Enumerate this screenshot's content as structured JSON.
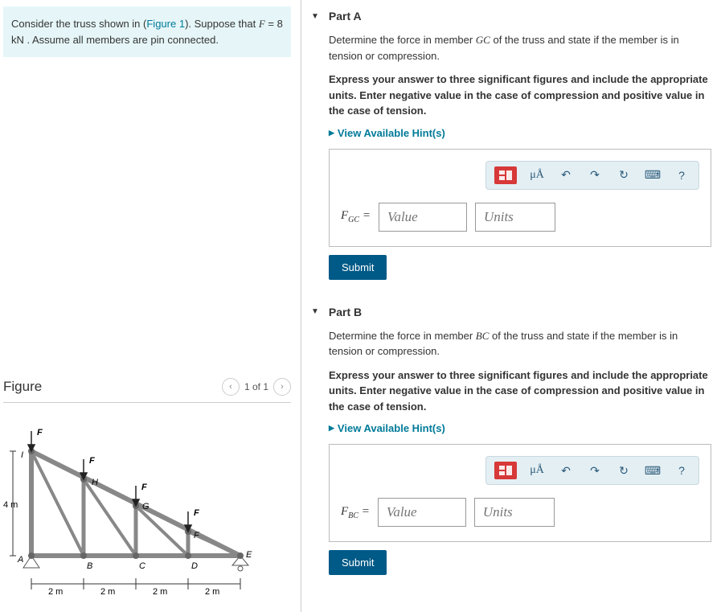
{
  "problem": {
    "text_pre": "Consider the truss shown in (",
    "figure_link": "Figure 1",
    "text_mid": "). Suppose that ",
    "var_f": "F",
    "equals": " = 8 kN",
    "text_post": " . Assume all members are pin connected."
  },
  "figure": {
    "title": "Figure",
    "counter": "1 of 1",
    "labels": {
      "A": "A",
      "B": "B",
      "C": "C",
      "D": "D",
      "E": "E",
      "F": "F",
      "G": "G",
      "H": "H",
      "I": "I"
    },
    "dims": {
      "height": "4 m",
      "span": "2 m"
    },
    "load": "F"
  },
  "partA": {
    "title": "Part A",
    "question_pre": "Determine the force in member ",
    "member": "GC",
    "question_post": " of the truss and state if the member is in tension or compression.",
    "instruction": "Express your answer to three significant figures and include the appropriate units. Enter negative value in the case of compression and positive value in the case of tension.",
    "hints": "View Available Hint(s)",
    "label_pre": "F",
    "label_sub": "GC",
    "label_post": " =",
    "value_ph": "Value",
    "units_ph": "Units",
    "submit": "Submit"
  },
  "partB": {
    "title": "Part B",
    "question_pre": "Determine the force in member ",
    "member": "BC",
    "question_post": " of the truss and state if the member is in tension or compression.",
    "instruction": "Express your answer to three significant figures and include the appropriate units. Enter negative value in the case of compression and positive value in the case of tension.",
    "hints": "View Available Hint(s)",
    "label_pre": "F",
    "label_sub": "BC",
    "label_post": " =",
    "value_ph": "Value",
    "units_ph": "Units",
    "submit": "Submit"
  },
  "toolbar": {
    "ua": "μÅ",
    "help": "?"
  }
}
